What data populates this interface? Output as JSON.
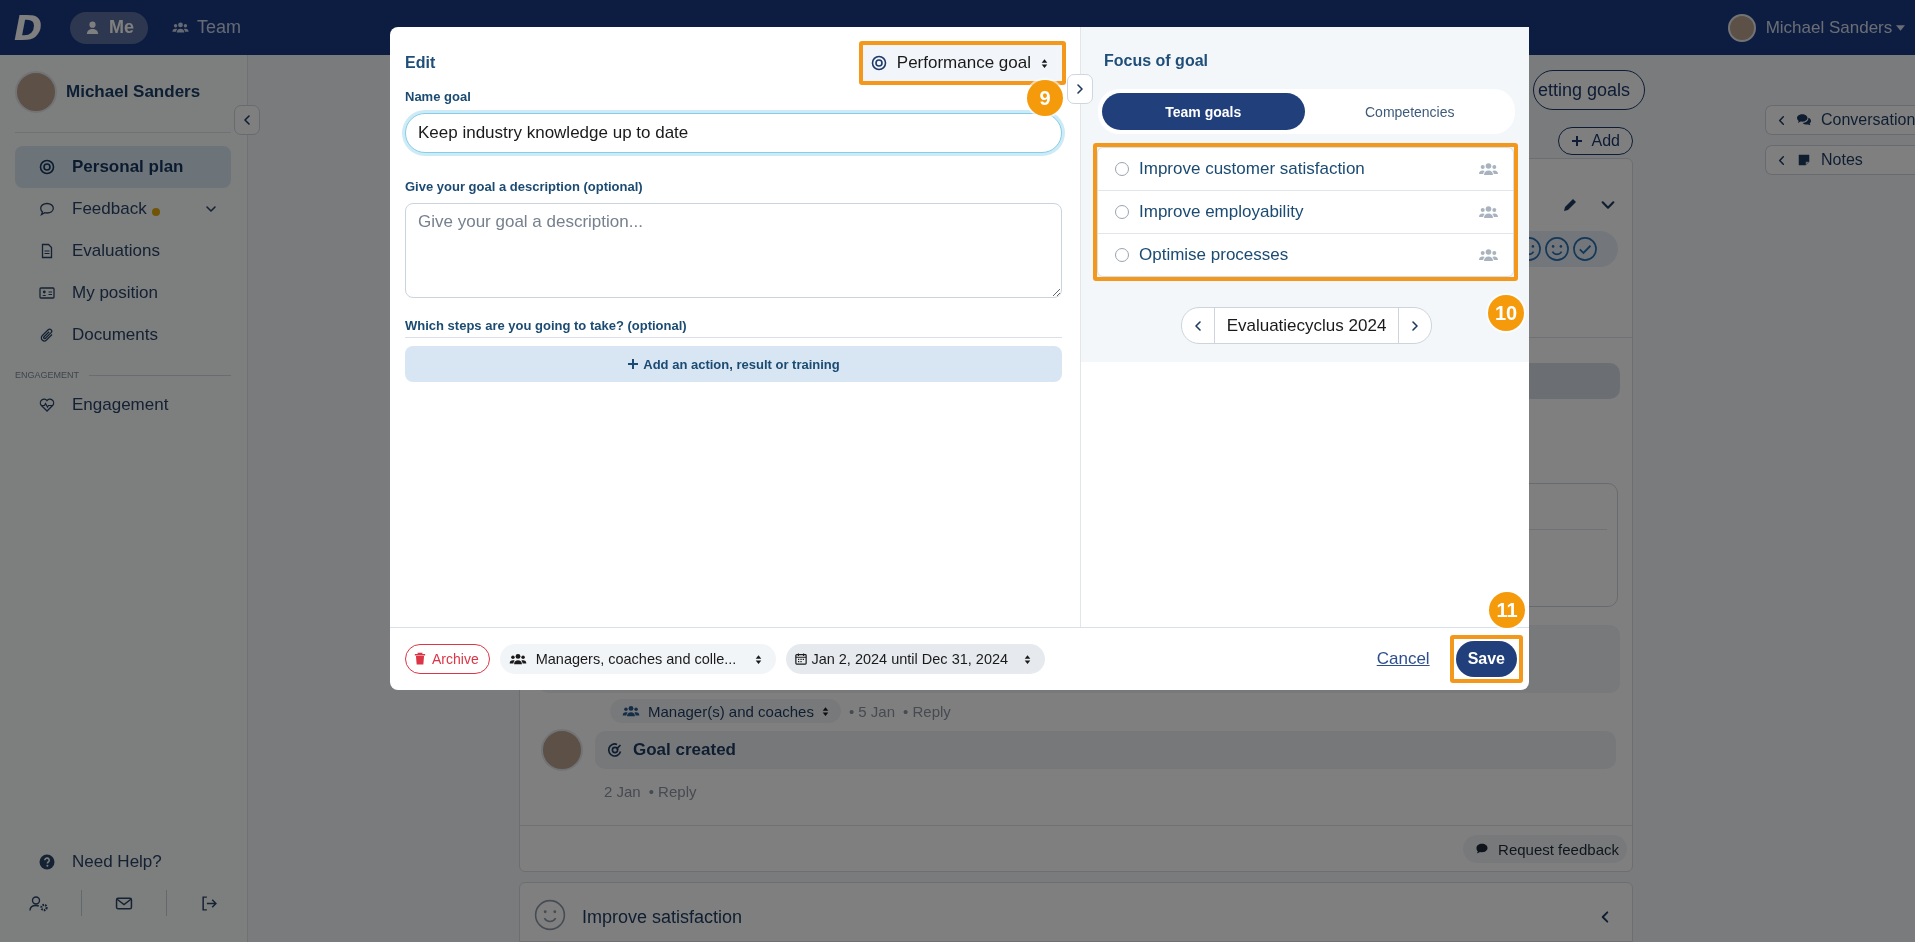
{
  "top_bar": {
    "logo": "D",
    "nav": [
      {
        "label": "Me",
        "kind": "user",
        "selected": true
      },
      {
        "label": "Team",
        "kind": "users",
        "selected": false
      }
    ],
    "user_name": "Michael Sanders"
  },
  "sidebar": {
    "user_name": "Michael Sanders",
    "items": [
      {
        "label": "Personal plan",
        "kind": "target",
        "selected": true,
        "dot": false,
        "expandable": false
      },
      {
        "label": "Feedback",
        "kind": "chat",
        "selected": false,
        "dot": true,
        "expandable": true
      },
      {
        "label": "Evaluations",
        "kind": "document",
        "selected": false,
        "dot": false,
        "expandable": false
      },
      {
        "label": "My position",
        "kind": "id-card",
        "selected": false,
        "dot": false,
        "expandable": false
      },
      {
        "label": "Documents",
        "kind": "paperclip",
        "selected": false,
        "dot": false,
        "expandable": false
      }
    ],
    "section": "ENGAGEMENT",
    "section_items": [
      {
        "label": "Engagement",
        "kind": "heart",
        "selected": false,
        "dot": false,
        "expandable": false
      }
    ],
    "help": "Need Help?"
  },
  "background": {
    "setting_goals": "etting goals",
    "add": "Add",
    "side_buttons": [
      {
        "label": "Conversation",
        "kind": "comments"
      },
      {
        "label": "Notes",
        "kind": "note"
      }
    ],
    "audience": "Manager(s) and coaches",
    "audience_date": "• 5 Jan",
    "audience_reply": "• Reply",
    "event": "Goal created",
    "event_date": "2 Jan",
    "event_reply": "• Reply",
    "request_feedback": "Request feedback",
    "next_goal": "Improve satisfaction"
  },
  "modal": {
    "title": "Edit",
    "goal_type": "Performance goal",
    "goal_type_callout": "9",
    "name_label": "Name goal",
    "name_value": "Keep industry knowledge up to date",
    "description_label": "Give your goal a description (optional)",
    "description_placeholder": "Give your goal a description...",
    "steps_label": "Which steps are you going to take? (optional)",
    "add_step": "Add an action, result or training",
    "focus": {
      "title": "Focus of goal",
      "tabs": [
        {
          "label": "Team goals",
          "selected": true
        },
        {
          "label": "Competencies",
          "selected": false
        }
      ],
      "options": [
        {
          "label": "Improve customer satisfaction",
          "selected": false
        },
        {
          "label": "Improve employability",
          "selected": false
        },
        {
          "label": "Optimise processes",
          "selected": false
        }
      ],
      "options_callout": "10",
      "cycle": "Evaluatiecyclus 2024"
    },
    "footer": {
      "archive": "Archive",
      "visibility": "Managers, coaches and colle...",
      "period": "Jan 2, 2024 until Dec 31, 2024",
      "cancel": "Cancel",
      "save": "Save",
      "save_callout": "11"
    }
  }
}
